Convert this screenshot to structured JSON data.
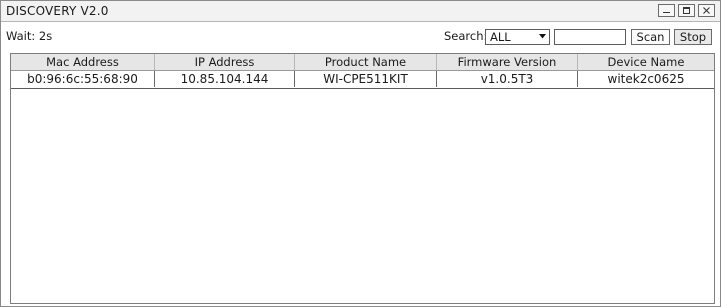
{
  "window": {
    "title": "DISCOVERY V2.0",
    "controls": [
      "minimize-icon",
      "maximize-icon",
      "close-icon"
    ]
  },
  "toolbar": {
    "status": "Wait: 2s",
    "search_label": "Search:",
    "search_scope": "ALL",
    "search_value": "",
    "scan_label": "Scan",
    "stop_label": "Stop"
  },
  "table": {
    "columns": [
      "Mac Address",
      "IP Address",
      "Product Name",
      "Firmware Version",
      "Device Name"
    ],
    "rows": [
      [
        "b0:96:6c:55:68:90",
        "10.85.104.144",
        "WI-CPE511KIT",
        "v1.0.5T3",
        "witek2c0625"
      ]
    ]
  }
}
